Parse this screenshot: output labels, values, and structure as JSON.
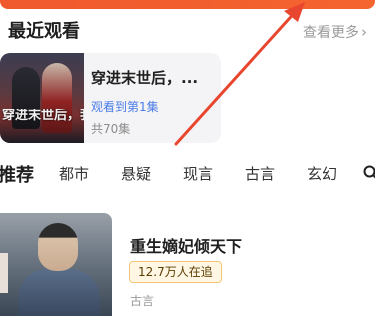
{
  "header": {
    "section_title": "最近观看",
    "see_more": "查看更多",
    "see_more_icon": "chevron-right-icon"
  },
  "recent": {
    "poster_title": "穿进末世后，我被囚禁了",
    "name": "穿进末世后，...",
    "progress": "观看到第1集",
    "total": "共70集"
  },
  "tabs": {
    "items": [
      "推荐",
      "都市",
      "悬疑",
      "现言",
      "古言",
      "玄幻"
    ],
    "active_index": 0,
    "search_icon": "search-icon"
  },
  "feature": {
    "name": "重生嫡妃倾天下",
    "heat": "12.7万人在追",
    "genre": "古言"
  },
  "colors": {
    "accent": "#f0582e",
    "link_blue": "#4a7be8",
    "badge_bg": "#fff6e3",
    "badge_border": "#f2c777",
    "annotation_arrow": "#e8462e"
  }
}
